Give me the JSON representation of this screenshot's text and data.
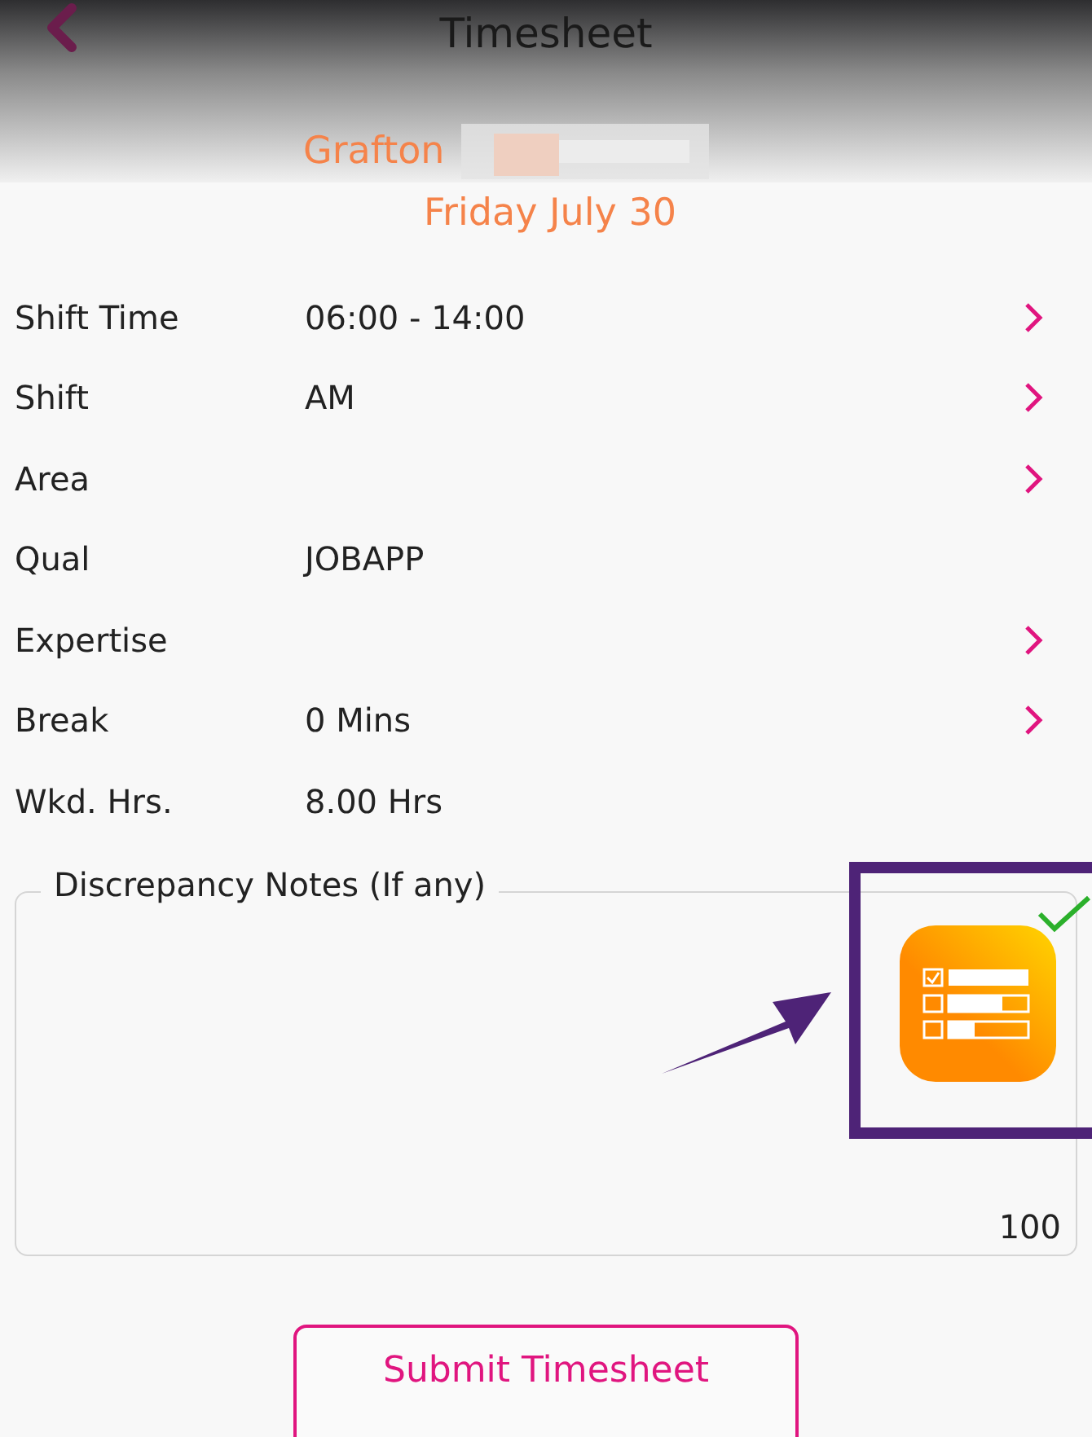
{
  "header": {
    "title": "Timesheet"
  },
  "location": "Grafton",
  "date": "Friday July 30",
  "rows": [
    {
      "label": "Shift Time",
      "value": "06:00 - 14:00",
      "has_chevron": true
    },
    {
      "label": "Shift",
      "value": "AM",
      "has_chevron": true
    },
    {
      "label": "Area",
      "value": "",
      "has_chevron": true
    },
    {
      "label": "Qual",
      "value": "JOBAPP",
      "has_chevron": false
    },
    {
      "label": "Expertise",
      "value": "",
      "has_chevron": true
    },
    {
      "label": "Break",
      "value": "0 Mins",
      "has_chevron": true
    },
    {
      "label": "Wkd. Hrs.",
      "value": "8.00 Hrs",
      "has_chevron": false
    }
  ],
  "notes": {
    "label": "Discrepancy Notes (If any)",
    "counter": "100"
  },
  "submit_button": "Submit Timesheet"
}
